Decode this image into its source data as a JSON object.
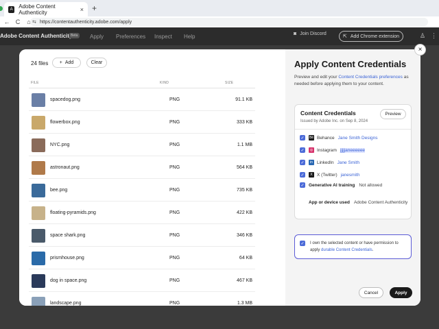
{
  "browser": {
    "tab_title": "Adobe Content Authenticity",
    "tab_close": "×",
    "new_tab": "+",
    "url": "https://contentauthenticity.adobe.com/apply",
    "nav": {
      "back": "←",
      "forward": "→",
      "reload": "C",
      "home": "⌂",
      "site_info": "⇆"
    }
  },
  "app_bar": {
    "brand": "Adobe Content Authenticity",
    "beta": "Beta",
    "nav": [
      "Apply",
      "Preferences",
      "Inspect",
      "Help"
    ],
    "join_discord": "Join Discord",
    "add_extension": "Add Chrome extension",
    "account_icon": "♙",
    "apps_icon": "⋮⋮"
  },
  "modal": {
    "close": "×",
    "files_count": "24 files",
    "add_label": "Add",
    "add_icon": "+",
    "clear_label": "Clear",
    "columns": {
      "file": "FILE",
      "kind": "KIND",
      "size": "SIZE"
    },
    "files": [
      {
        "name": "spacedog.png",
        "kind": "PNG",
        "size": "91.1 KB",
        "thumb_color": "#6a7fa6"
      },
      {
        "name": "flowerbox.png",
        "kind": "PNG",
        "size": "333 KB",
        "thumb_color": "#c9a86a"
      },
      {
        "name": "NYC.png",
        "kind": "PNG",
        "size": "1.1 MB",
        "thumb_color": "#8a6b5a"
      },
      {
        "name": "astronaut.png",
        "kind": "PNG",
        "size": "564 KB",
        "thumb_color": "#b07a4a"
      },
      {
        "name": "bee.png",
        "kind": "PNG",
        "size": "735 KB",
        "thumb_color": "#3a6a9a"
      },
      {
        "name": "floating-pyramids.png",
        "kind": "PNG",
        "size": "422 KB",
        "thumb_color": "#c7b28a"
      },
      {
        "name": "space shark.png",
        "kind": "PNG",
        "size": "346 KB",
        "thumb_color": "#4a5a6a"
      },
      {
        "name": "prismhouse.png",
        "kind": "PNG",
        "size": "64 KB",
        "thumb_color": "#2a6aa8"
      },
      {
        "name": "dog in space.png",
        "kind": "PNG",
        "size": "467 KB",
        "thumb_color": "#2a3a5a"
      },
      {
        "name": "landscape.png",
        "kind": "PNG",
        "size": "1.3 MB",
        "thumb_color": "#8aa0b8"
      }
    ]
  },
  "panel": {
    "title": "Apply Content Credentials",
    "desc_before": "Preview and edit your ",
    "desc_link": "Content Credentials preferences",
    "desc_after": " as needed before applying them to your content.",
    "card": {
      "title": "Content Credentials",
      "issued": "Issued by Adobe Inc. on Sep 8, 2024",
      "preview": "Preview",
      "credentials": [
        {
          "icon": "Bē",
          "icon_color": "#1a1a1a",
          "platform": "Behance",
          "value": "Jane Smith Designs",
          "highlight": false
        },
        {
          "icon": "◎",
          "icon_color": "#d6336c",
          "platform": "Instagram",
          "value": "jjjjjaneeeeee",
          "highlight": true
        },
        {
          "icon": "in",
          "icon_color": "#2867b2",
          "platform": "LinkedIn",
          "value": "Jane Smith",
          "highlight": false
        },
        {
          "icon": "X",
          "icon_color": "#1a1a1a",
          "platform": "X (Twitter)",
          "value": "janesmith",
          "highlight": false
        }
      ],
      "ai_label": "Generative AI training",
      "ai_value": "Not allowed",
      "device_label": "App or device used",
      "device_value": "Adobe Content Authenticity"
    },
    "consent_before": "I own the selected content or have permission to apply ",
    "consent_link": "durable Content Credentials",
    "consent_after": ".",
    "checkmark": "✓",
    "cancel": "Cancel",
    "apply": "Apply"
  }
}
